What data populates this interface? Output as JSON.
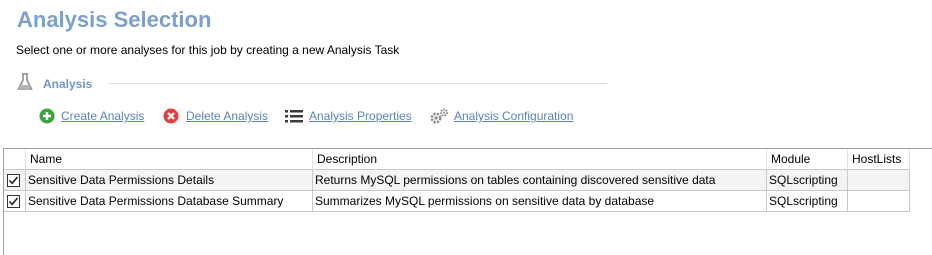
{
  "header": {
    "title": "Analysis Selection",
    "subtitle": "Select one or more analyses for this job by creating a new Analysis Task"
  },
  "section": {
    "label": "Analysis",
    "icon": "flask-icon"
  },
  "toolbar": {
    "create_label": "Create Analysis",
    "delete_label": "Delete Analysis",
    "properties_label": "Analysis Properties",
    "configuration_label": "Analysis Configuration"
  },
  "grid": {
    "columns": [
      "Name",
      "Description",
      "Module",
      "HostLists"
    ],
    "rows": [
      {
        "checked": true,
        "name": "Sensitive Data Permissions Details",
        "description": "Returns MySQL permissions on tables containing discovered sensitive data",
        "module": "SQLscripting",
        "hostlists": ""
      },
      {
        "checked": true,
        "name": "Sensitive Data Permissions Database Summary",
        "description": "Summarizes MySQL permissions on sensitive data by database",
        "module": "SQLscripting",
        "hostlists": ""
      }
    ]
  },
  "colors": {
    "title": "#7b9fd2",
    "link": "#5a82c4",
    "create_icon": "#3aa53a",
    "delete_icon": "#e04040"
  }
}
